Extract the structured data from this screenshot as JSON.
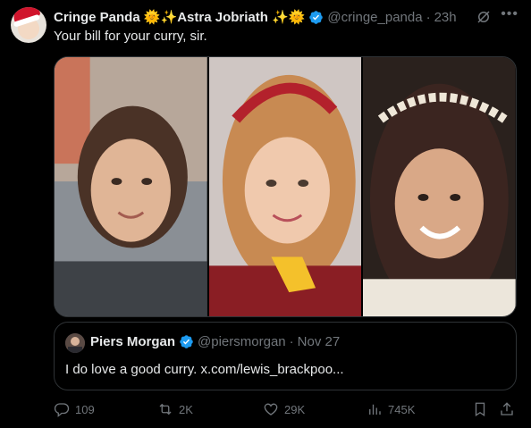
{
  "tweet": {
    "display_name": "Cringe Panda 🌞✨Astra Jobriath ✨🌞",
    "handle": "@cringe_panda",
    "separator": "·",
    "time": "23h",
    "text": "Your bill for your curry, sir."
  },
  "quoted": {
    "display_name": "Piers Morgan",
    "handle": "@piersmorgan",
    "separator": "·",
    "time": "Nov 27",
    "text": "I do love a good curry. x.com/lewis_brackpoo..."
  },
  "actions": {
    "replies": "109",
    "retweets": "2K",
    "likes": "29K",
    "views": "745K"
  },
  "icons": {
    "verified": "verified-badge-icon",
    "grok": "grok-icon",
    "more": "more-icon",
    "reply": "reply-icon",
    "retweet": "retweet-icon",
    "like": "heart-icon",
    "views": "views-icon",
    "bookmark": "bookmark-icon",
    "share": "share-icon"
  },
  "colors": {
    "background": "#000000",
    "text": "#e7e9ea",
    "secondary": "#71767b",
    "verified": "#1d9bf0",
    "border": "#2f3336"
  }
}
